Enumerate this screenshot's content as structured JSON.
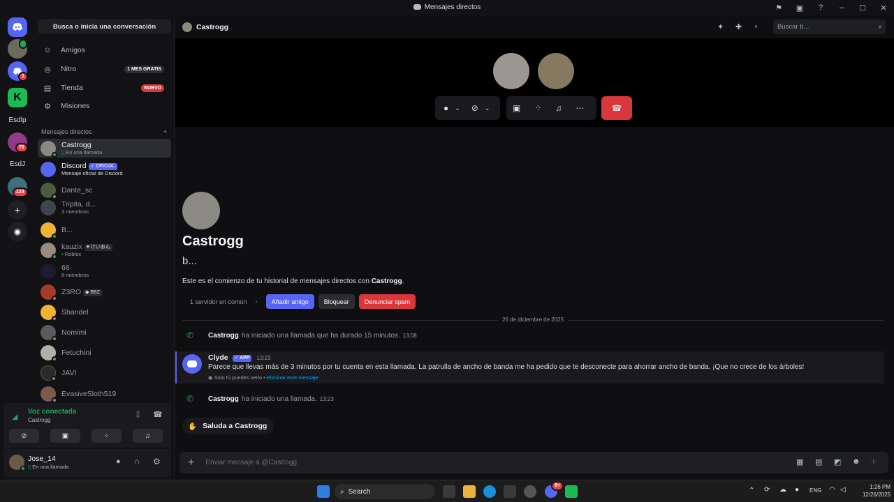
{
  "window": {
    "title": "Mensajes directos"
  },
  "servers": {
    "labels": [
      "Esdlp",
      "EsdJ"
    ],
    "badges": [
      "1",
      "79",
      "124"
    ]
  },
  "dm_panel": {
    "search_label": "Busca o inicia una conversación",
    "nav": [
      {
        "label": "Amigos"
      },
      {
        "label": "Nitro",
        "pill": "1 MES GRATIS"
      },
      {
        "label": "Tienda",
        "pill": "NUEVO"
      },
      {
        "label": "Misiones"
      }
    ],
    "section_header": "Mensajes directos",
    "dms": [
      {
        "name": "Castrogg",
        "sub": "En una llamada"
      },
      {
        "name": "Discord",
        "tag": "OFICIAL",
        "sub": "Mensaje oficial de Discord"
      },
      {
        "name": "Dante_sc"
      },
      {
        "name": "Tripita, d...",
        "sub": "3 miembros"
      },
      {
        "name": "B..."
      },
      {
        "name": "kauzix",
        "tag": "けいおん",
        "sub": "Roblox"
      },
      {
        "name": "66",
        "sub": "8 miembros"
      },
      {
        "name": "Z3RO",
        "tag": "BBZ"
      },
      {
        "name": "Shandel"
      },
      {
        "name": "Nomimi"
      },
      {
        "name": "Fetuchini"
      },
      {
        "name": "JAVI"
      },
      {
        "name": "EvasiveSloth519"
      }
    ]
  },
  "voice": {
    "status": "Voz conectada",
    "channel": "Castrogg"
  },
  "user": {
    "name": "Jose_14",
    "status": "En una llamada"
  },
  "header": {
    "channel": "Castrogg",
    "search_placeholder": "Buscar b..."
  },
  "intro": {
    "name": "Castrogg",
    "subtitle": "b...",
    "text_prefix": "Este es el comienzo de tu historial de mensajes directos con ",
    "text_name": "Castrogg",
    "text_suffix": ".",
    "mutual": "1 servidor en común",
    "dot": "•",
    "add_friend": "Añadir amigo",
    "block": "Bloquear",
    "report": "Denunciar spam"
  },
  "date_divider": "26 de diciembre de 2025",
  "messages": [
    {
      "author": "Castrogg",
      "text": "ha iniciado una llamada que ha durado 15 minutos.",
      "time": "13:08"
    },
    {
      "author": "Clyde",
      "tag": "APP",
      "time": "13:23",
      "text": "Parece que llevas más de 3 minutos por tu cuenta en esta llamada. La patrulla de ancho de banda me ha pedido que te desconecte para ahorrar ancho de banda. ¡Que no crece de los árboles!",
      "note": "Solo tú puedes verlo •",
      "note_link": "Eliminar este mensaje"
    },
    {
      "author": "Castrogg",
      "text": "ha iniciado una llamada.",
      "time": "13:23"
    }
  ],
  "greet": "Saluda a Castrogg",
  "composer": {
    "placeholder": "Enviar mensaje a @Castrogg"
  },
  "taskbar": {
    "search": "Search",
    "lang": "ENG",
    "time": "1:26 PM",
    "date": "12/26/2025",
    "badge": "9+"
  },
  "colors": {
    "blurple": "#5865f2",
    "red": "#da373c",
    "green": "#23a55a"
  }
}
